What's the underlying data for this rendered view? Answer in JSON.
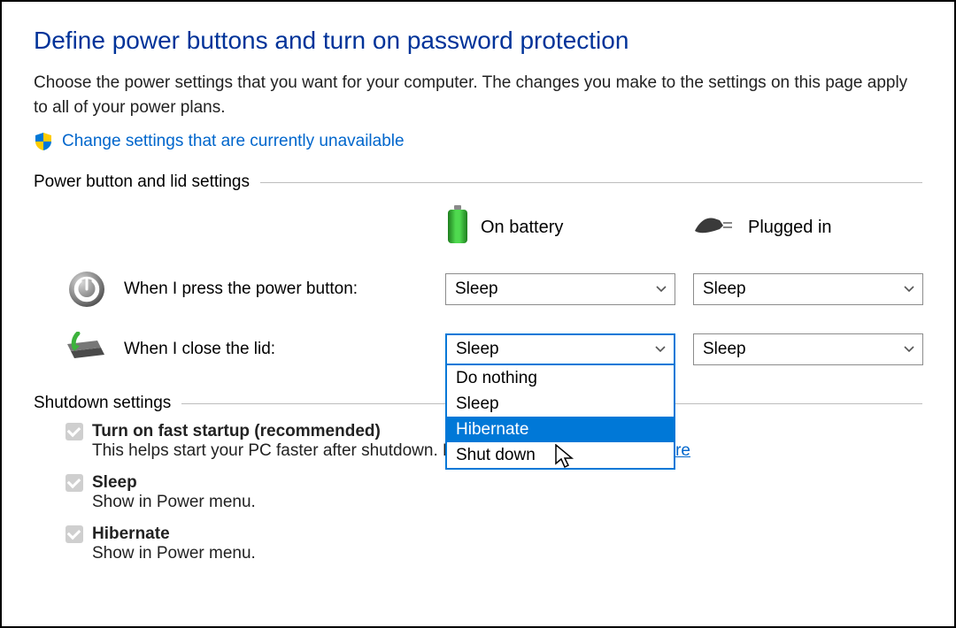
{
  "title": "Define power buttons and turn on password protection",
  "description": "Choose the power settings that you want for your computer. The changes you make to the settings on this page apply to all of your power plans.",
  "change_link": "Change settings that are currently unavailable",
  "sections": {
    "power_button": "Power button and lid settings",
    "shutdown": "Shutdown settings"
  },
  "columns": {
    "battery": "On battery",
    "plugged": "Plugged in"
  },
  "rows": {
    "power_button_label": "When I press the power button:",
    "close_lid_label": "When I close the lid:"
  },
  "selects": {
    "power_button_battery": "Sleep",
    "power_button_plugged": "Sleep",
    "close_lid_battery": "Sleep",
    "close_lid_plugged": "Sleep",
    "close_lid_battery_options": [
      "Do nothing",
      "Sleep",
      "Hibernate",
      "Shut down"
    ],
    "close_lid_battery_highlight": "Hibernate"
  },
  "shutdown": {
    "fast_startup_label": "Turn on fast startup (recommended)",
    "fast_startup_desc": "This helps start your PC faster after shutdown. Restart isn't affected.",
    "learn_more": "Learn More",
    "sleep_label": "Sleep",
    "sleep_desc": "Show in Power menu.",
    "hibernate_label": "Hibernate",
    "hibernate_desc": "Show in Power menu."
  }
}
